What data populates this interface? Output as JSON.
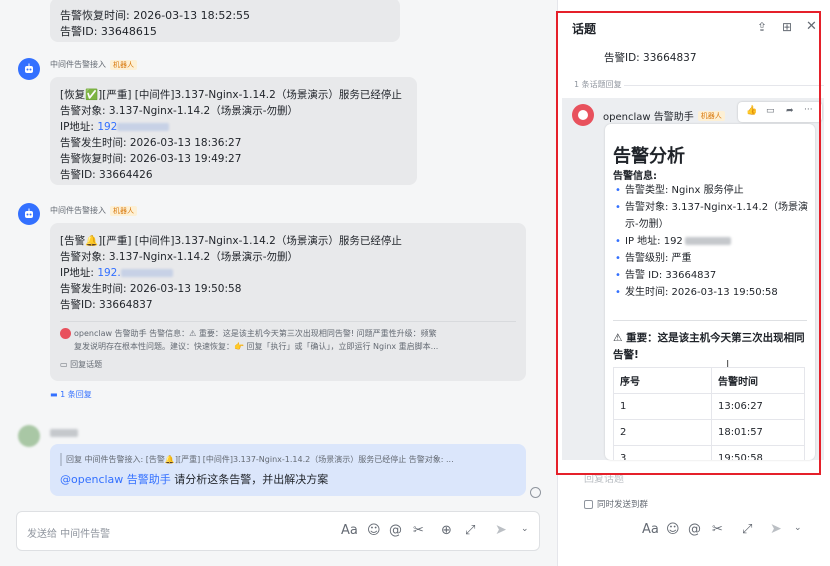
{
  "chat": {
    "msg0": {
      "line1": "告警恢复时间: 2026-03-13 18:52:55",
      "line2": "告警ID: 33648615"
    },
    "msg1": {
      "sender": "中间件告警接入",
      "tag": "机器人",
      "line1": "[恢复✅][严重] [中间件]3.137-Nginx-1.14.2（场景演示）服务已经停止",
      "line2": "告警对象: 3.137-Nginx-1.14.2（场景演示-勿删）",
      "ip_label": "IP地址:",
      "ip_value": "192",
      "line4": "告警发生时间: 2026-03-13 18:36:27",
      "line5": "告警恢复时间: 2026-03-13 19:49:27",
      "line6": "告警ID: 33664426"
    },
    "msg2": {
      "sender": "中间件告警接入",
      "tag": "机器人",
      "line1": "[告警🔔][严重] [中间件]3.137-Nginx-1.14.2（场景演示）服务已经停止",
      "line2": "告警对象: 3.137-Nginx-1.14.2（场景演示-勿删）",
      "ip_label": "IP地址:",
      "ip_value": "192.",
      "line4": "告警发生时间: 2026-03-13 19:50:58",
      "line5": "告警ID: 33664837",
      "reply_preview_1": "openclaw 告警助手  告警信息：⚠ 重要：这是该主机今天第三次出现相同告警! 问题严重性升级：频繁",
      "reply_preview_2": "复发说明存在根本性问题。建议：快速恢复：👉 回复「执行」或「确认」，立即运行 Nginx 重启脚本...",
      "reply_topic": "回复话题",
      "reply_count": "1 条回复"
    },
    "msg3": {
      "quote": "回复 中间件告警接入: [告警🔔][严重] [中间件]3.137-Nginx-1.14.2（场景演示）服务已经停止 告警对象: ...",
      "mention": "@openclaw 告警助手",
      "text": " 请分析这条告警，并出解决方案"
    },
    "compose_placeholder": "发送给 中间件告警"
  },
  "thread": {
    "title": "话题",
    "alarm_id": "告警ID: 33664837",
    "reply_count": "1 条话题回复",
    "bot_name": "openclaw 告警助手",
    "bot_tag": "机器人",
    "card": {
      "title": "告警分析",
      "section": "告警信息:",
      "items": [
        "告警类型: Nginx 服务停止",
        "告警对象: 3.137-Nginx-1.14.2（场景演示-勿删）",
        "IP 地址: 192",
        "告警级别: 严重",
        "告警 ID: 33664837",
        "发生时间: 2026-03-13 19:50:58"
      ],
      "warning": "⚠ 重要：这是该主机今天第三次出现相同告警!",
      "table_headers": [
        "序号",
        "告警时间"
      ],
      "table_rows": [
        [
          "1",
          "13:06:27"
        ],
        [
          "2",
          "18:01:57"
        ],
        [
          "3",
          "19:50:58"
        ]
      ]
    },
    "reply_placeholder": "回复话题",
    "send_to_group": "同时发送到群"
  },
  "colors": {
    "accent": "#3370ff",
    "highlight": "#e5202a",
    "bubble": "#e8e9eb"
  }
}
